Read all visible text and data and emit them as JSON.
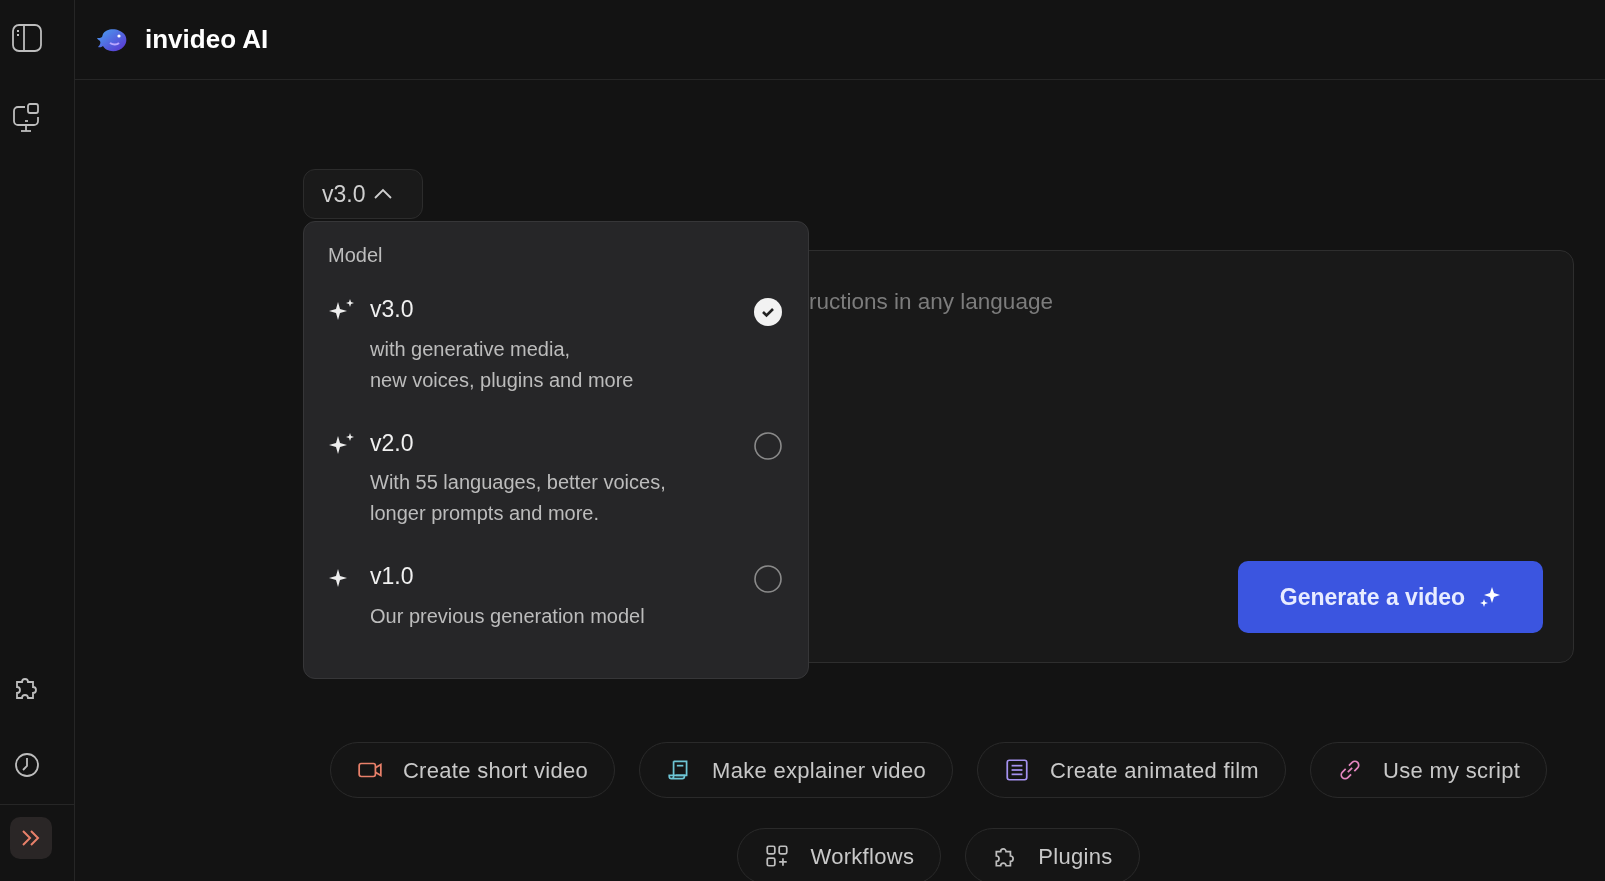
{
  "header": {
    "brand": "invideo AI"
  },
  "model_selector": {
    "value": "v3.0",
    "expanded": true
  },
  "model_menu": {
    "heading": "Model",
    "options": [
      {
        "name": "v3.0",
        "description": "with generative media,\nnew voices, plugins and more",
        "kind": "sparkles",
        "selected": true
      },
      {
        "name": "v2.0",
        "description": "With 55 languages, better voices,\nlonger prompts and more.",
        "kind": "sparkles",
        "selected": false
      },
      {
        "name": "v1.0",
        "description": "Our previous generation model",
        "kind": "sparkle",
        "selected": false
      }
    ]
  },
  "prompt": {
    "placeholder": "ructions in any language"
  },
  "generate_button": {
    "label": "Generate a video"
  },
  "quick_actions": [
    {
      "label": "Create short video",
      "kind": "video",
      "color": "#e8806a"
    },
    {
      "label": "Make explainer video",
      "kind": "explainer",
      "color": "#6ec6d6"
    },
    {
      "label": "Create animated film",
      "kind": "film",
      "color": "#a592f0"
    },
    {
      "label": "Use my script",
      "kind": "link",
      "color": "#e486c0"
    }
  ],
  "more_actions": [
    {
      "label": "Workflows",
      "kind": "workflows"
    },
    {
      "label": "Plugins",
      "kind": "plugins"
    }
  ]
}
